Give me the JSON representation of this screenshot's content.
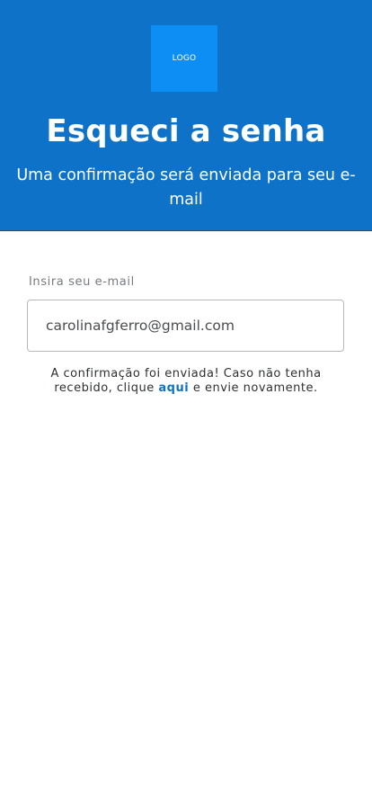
{
  "header": {
    "logo_text": "LOGO",
    "title": "Esqueci a senha",
    "subtitle": "Uma confirmação será enviada para seu e-mail",
    "background_color": "#0f72c9",
    "logo_color": "#0d8ef5"
  },
  "form": {
    "email_label": "Insira seu e-mail",
    "email_value": "carolinafgferro@gmail.com"
  },
  "message": {
    "text_before": "A confirmação foi enviada! Caso não tenha recebido, clique ",
    "link_text": "aqui",
    "text_after": " e envie novamente.",
    "link_color": "#0f72c9"
  }
}
